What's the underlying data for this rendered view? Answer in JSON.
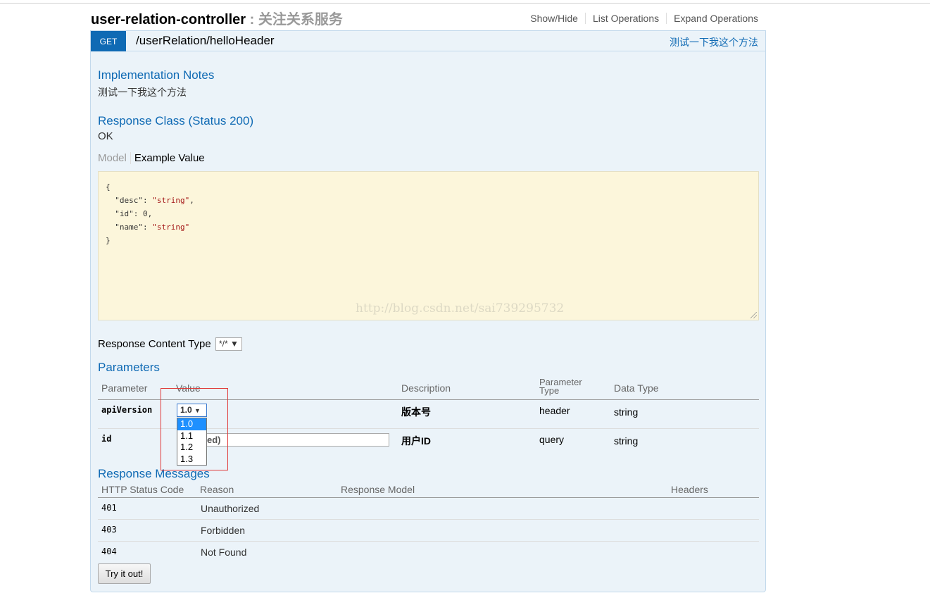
{
  "controller": {
    "name": "user-relation-controller",
    "separator": " : ",
    "description": "关注关系服务",
    "links": [
      "Show/Hide",
      "List Operations",
      "Expand Operations"
    ]
  },
  "operation": {
    "method": "GET",
    "path": "/userRelation/helloHeader",
    "summary": "测试一下我这个方法",
    "implementation_notes_title": "Implementation Notes",
    "implementation_notes": "测试一下我这个方法",
    "response_class_title": "Response Class (Status 200)",
    "response_class_value": "OK",
    "tabs": {
      "model": "Model",
      "example": "Example Value"
    },
    "example": {
      "open": "{",
      "lines": [
        {
          "key": "\"desc\"",
          "value": "\"string\"",
          "comma": ","
        },
        {
          "key": "\"id\"",
          "value": "0",
          "comma": ","
        },
        {
          "key": "\"name\"",
          "value": "\"string\"",
          "comma": ""
        }
      ],
      "close": "}"
    },
    "watermark": "http://blog.csdn.net/sai739295732",
    "response_content_type_label": "Response Content Type",
    "response_content_type_value": "*/*"
  },
  "parameters": {
    "title": "Parameters",
    "headers": {
      "parameter": "Parameter",
      "value": "Value",
      "description": "Description",
      "parameter_type_line1": "Parameter",
      "parameter_type_line2": "Type",
      "data_type": "Data Type"
    },
    "rows": [
      {
        "name": "apiVersion",
        "value": "1.0",
        "description": "版本号",
        "param_type": "header",
        "data_type": "string"
      },
      {
        "name": "id",
        "value_visible": "ed)",
        "description": "用户ID",
        "param_type": "query",
        "data_type": "string"
      }
    ],
    "version_options": [
      "1.0",
      "1.1",
      "1.2",
      "1.3"
    ],
    "selected_option": "1.0"
  },
  "response_messages": {
    "title": "Response Messages",
    "headers": {
      "code": "HTTP Status Code",
      "reason": "Reason",
      "model": "Response Model",
      "headers": "Headers"
    },
    "rows": [
      {
        "code": "401",
        "reason": "Unauthorized"
      },
      {
        "code": "403",
        "reason": "Forbidden"
      },
      {
        "code": "404",
        "reason": "Not Found"
      }
    ]
  },
  "try_button": "Try it out!",
  "colors": {
    "get_method": "#0f6ab4",
    "op_background": "#ebf3f9",
    "snippet_background": "#fcf6db",
    "highlight_box": "#e03c3c"
  }
}
